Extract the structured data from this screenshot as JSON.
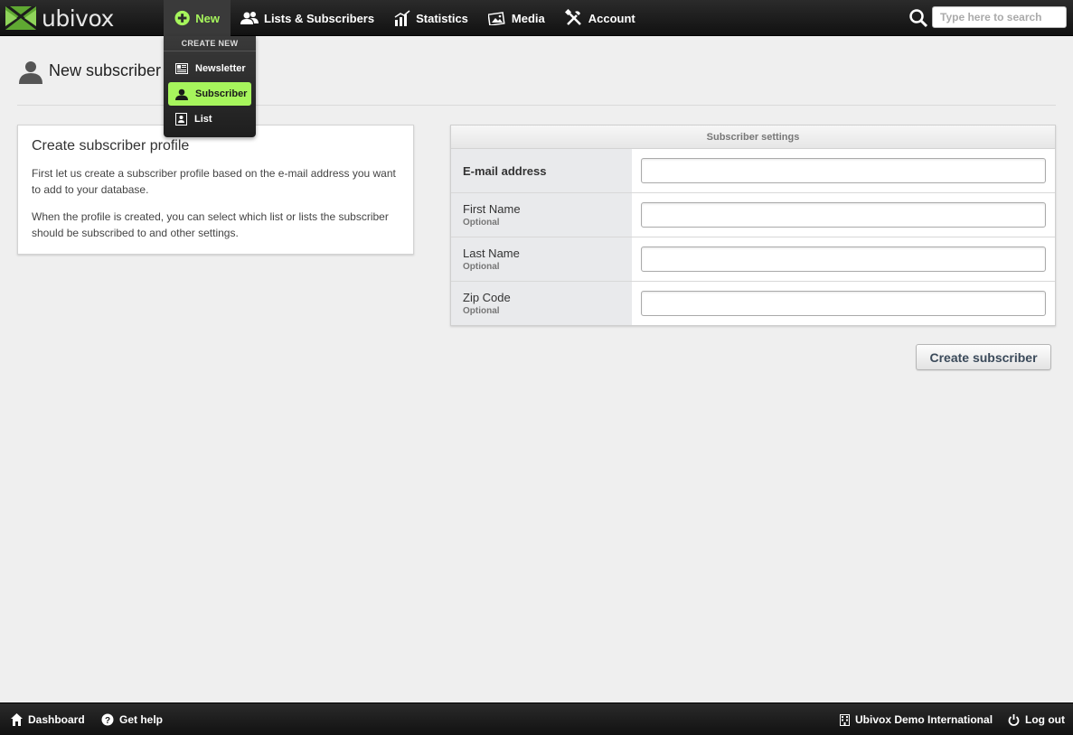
{
  "app": {
    "name": "ubivox",
    "accent": "#a6f55c"
  },
  "nav": {
    "new": "New",
    "lists": "Lists & Subscribers",
    "statistics": "Statistics",
    "media": "Media",
    "account": "Account"
  },
  "search": {
    "placeholder": "Type here to search",
    "value": ""
  },
  "dropdown": {
    "header": "CREATE NEW",
    "items": [
      {
        "label": "Newsletter",
        "icon": "newsletter-icon"
      },
      {
        "label": "Subscriber",
        "icon": "person-icon",
        "active": true
      },
      {
        "label": "List",
        "icon": "list-icon"
      }
    ]
  },
  "page": {
    "title": "New subscriber"
  },
  "info": {
    "title": "Create subscriber profile",
    "p1": "First let us create a subscriber profile based on the e-mail address you want to add to your database.",
    "p2": "When the profile is created, you can select which list or lists the subscriber should be subscribed to and other settings."
  },
  "settings": {
    "header": "Subscriber settings",
    "fields": [
      {
        "label": "E-mail address",
        "optional": "",
        "value": ""
      },
      {
        "label": "First Name",
        "optional": "Optional",
        "value": ""
      },
      {
        "label": "Last Name",
        "optional": "Optional",
        "value": ""
      },
      {
        "label": "Zip Code",
        "optional": "Optional",
        "value": ""
      }
    ],
    "submit": "Create subscriber"
  },
  "footer": {
    "dashboard": "Dashboard",
    "help": "Get help",
    "org": "Ubivox Demo International",
    "logout": "Log out"
  }
}
